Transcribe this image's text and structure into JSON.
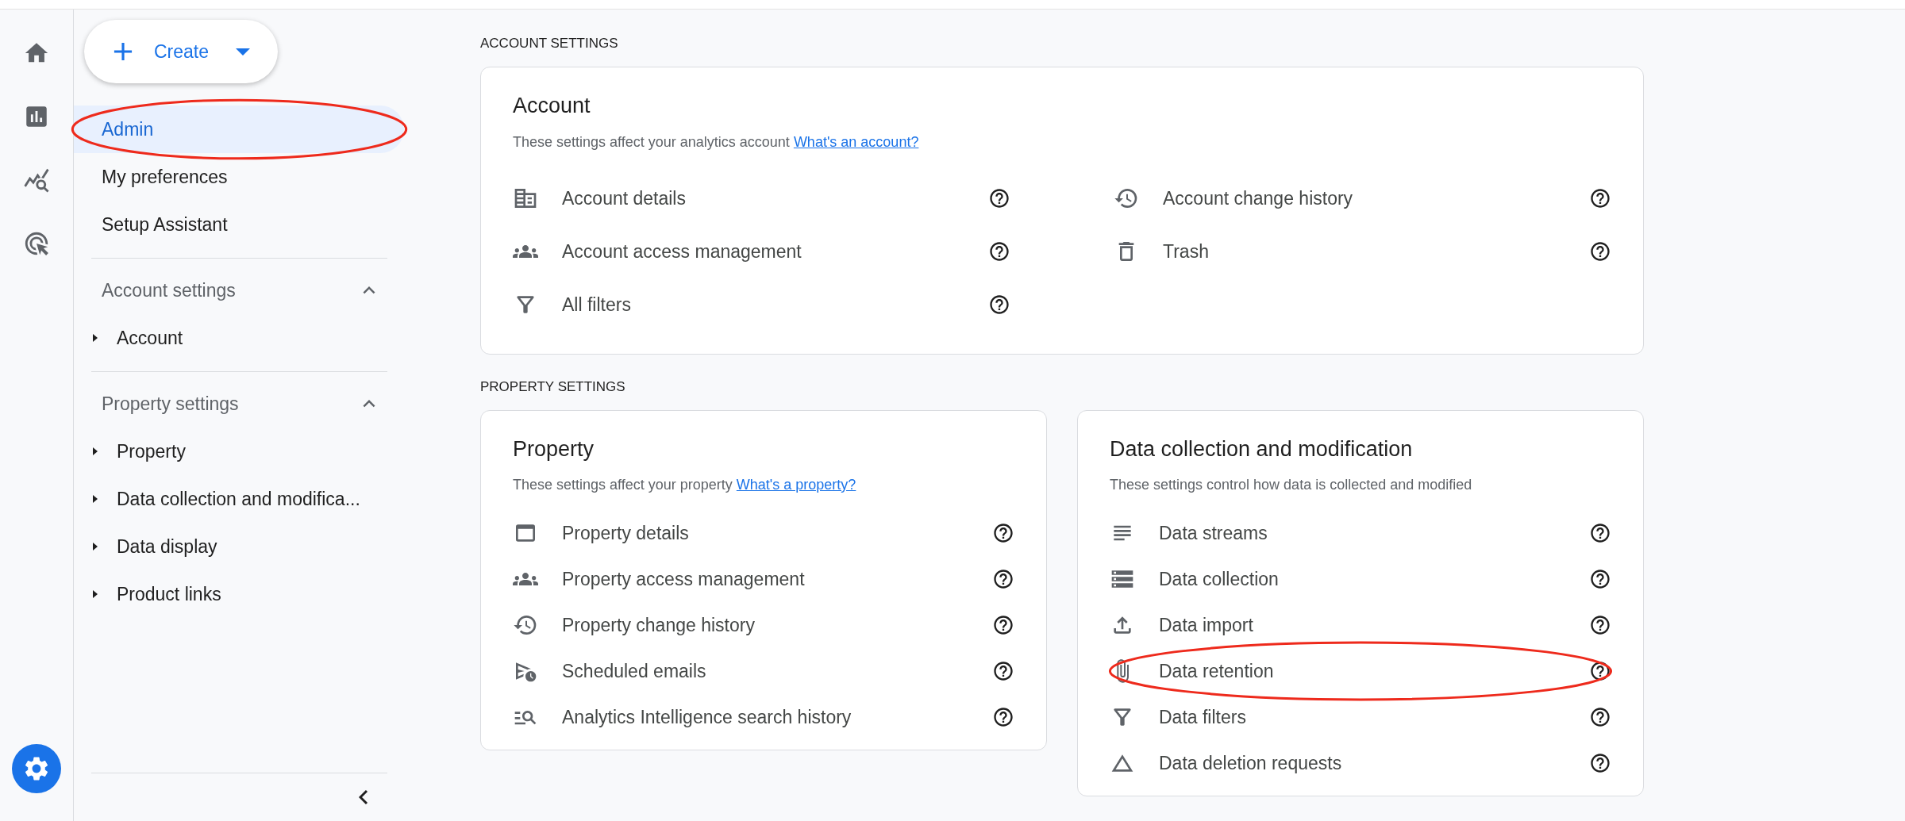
{
  "rail": {
    "items": [
      {
        "selected": false
      },
      {
        "selected": false
      },
      {
        "selected": false
      },
      {
        "selected": false
      }
    ],
    "settings_button": {
      "selected": true
    }
  },
  "create_button": {
    "label": "Create"
  },
  "nav": [
    {
      "label": "Admin",
      "selected": true,
      "circled": true
    },
    {
      "label": "My preferences",
      "selected": false,
      "circled": false
    },
    {
      "label": "Setup Assistant",
      "selected": false,
      "circled": false
    }
  ],
  "nav_sections": [
    {
      "title": "Account settings",
      "expanded": true,
      "items": [
        {
          "label": "Account",
          "expanded": false
        }
      ]
    },
    {
      "title": "Property settings",
      "expanded": true,
      "items": [
        {
          "label": "Property",
          "expanded": false
        },
        {
          "label": "Data collection and modifica...",
          "expanded": false
        },
        {
          "label": "Data display",
          "expanded": false
        },
        {
          "label": "Product links",
          "expanded": false
        }
      ]
    }
  ],
  "sections": [
    {
      "heading": "ACCOUNT SETTINGS",
      "cards": [
        {
          "title": "Account",
          "description": "These settings affect your analytics account",
          "link": "What's an account?",
          "columns": [
            [
              {
                "label": "Account details",
                "circled": false
              },
              {
                "label": "Account access management",
                "circled": false
              },
              {
                "label": "All filters",
                "circled": false
              }
            ],
            [
              {
                "label": "Account change history",
                "circled": false
              },
              {
                "label": "Trash",
                "circled": false
              }
            ]
          ]
        }
      ]
    },
    {
      "heading": "PROPERTY SETTINGS",
      "cards": [
        {
          "title": "Property",
          "description": "These settings affect your property",
          "link": "What's a property?",
          "columns": [
            [
              {
                "label": "Property details",
                "circled": false
              },
              {
                "label": "Property access management",
                "circled": false
              },
              {
                "label": "Property change history",
                "circled": false
              },
              {
                "label": "Scheduled emails",
                "circled": false
              },
              {
                "label": "Analytics Intelligence search history",
                "circled": false
              }
            ]
          ]
        },
        {
          "title": "Data collection and modification",
          "description": "These settings control how data is collected and modified",
          "columns": [
            [
              {
                "label": "Data streams",
                "circled": false
              },
              {
                "label": "Data collection",
                "circled": false
              },
              {
                "label": "Data import",
                "circled": false
              },
              {
                "label": "Data retention",
                "circled": true
              },
              {
                "label": "Data filters",
                "circled": false
              },
              {
                "label": "Data deletion requests",
                "circled": false
              }
            ]
          ]
        }
      ]
    }
  ]
}
